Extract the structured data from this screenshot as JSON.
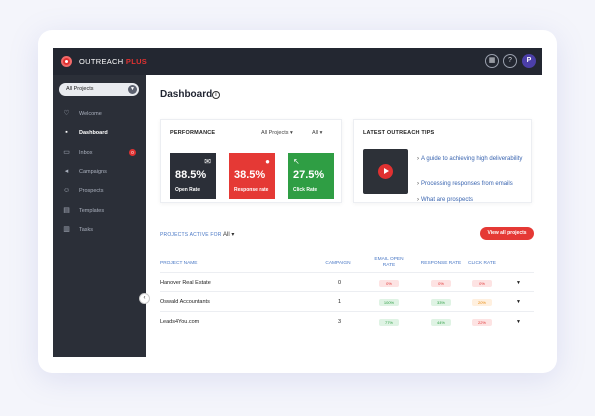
{
  "app": {
    "brand_name": "OUTREACH",
    "brand_suffix": "PLUS",
    "brand_color": "#e03131"
  },
  "topbar": {
    "icons": [
      "calendar-icon",
      "help-icon"
    ],
    "avatar_initial": "P"
  },
  "sidebar": {
    "project_select": "All Projects",
    "items": [
      {
        "label": "Welcome",
        "icon": "lightbulb-icon",
        "active": false
      },
      {
        "label": "Dashboard",
        "icon": "grid-icon",
        "active": true
      },
      {
        "label": "Inbox",
        "icon": "inbox-icon",
        "active": false,
        "badge": "0"
      },
      {
        "label": "Campaigns",
        "icon": "megaphone-icon",
        "active": false
      },
      {
        "label": "Prospects",
        "icon": "people-icon",
        "active": false
      },
      {
        "label": "Templates",
        "icon": "template-icon",
        "active": false
      },
      {
        "label": "Tasks",
        "icon": "tasks-icon",
        "active": false
      }
    ]
  },
  "page": {
    "title": "Dashboard",
    "info": "i"
  },
  "performance": {
    "title": "PERFORMANCE",
    "project_filter": "All Projects",
    "scope_filter": "All",
    "stats": [
      {
        "value": "88.5%",
        "label": "Open Rate",
        "color": "#2b2f38",
        "icon": "envelope-open-icon"
      },
      {
        "value": "38.5%",
        "label": "Response rate",
        "color": "#e53935",
        "icon": "chat-bubble-icon"
      },
      {
        "value": "27.5%",
        "label": "Click Rate",
        "color": "#2f9e44",
        "icon": "arrow-up-left-icon"
      }
    ]
  },
  "tips": {
    "title": "LATEST OUTREACH TIPS",
    "links": [
      "A guide to achieving high deliverability",
      "Processing responses from emails",
      "What are prospects"
    ]
  },
  "projects": {
    "active_for_label": "PROJECTS ACTIVE FOR",
    "active_for_value": "All",
    "view_all_label": "View all projects",
    "columns": [
      "PROJECT NAME",
      "CAMPAIGN",
      "EMAIL OPEN RATE",
      "RESPONSE RATE",
      "CLICK RATE"
    ],
    "rows": [
      {
        "name": "Hanover Real Estate",
        "campaign": "0",
        "open": "0%",
        "open_status": "red",
        "response": "0%",
        "response_status": "red",
        "click": "0%",
        "click_status": "red"
      },
      {
        "name": "Oswald Accountants",
        "campaign": "1",
        "open": "100%",
        "open_status": "green",
        "response": "33%",
        "response_status": "green",
        "click": "20%",
        "click_status": "orange"
      },
      {
        "name": "Leads4You.com",
        "campaign": "3",
        "open": "77%",
        "open_status": "green",
        "response": "44%",
        "response_status": "green",
        "click": "22%",
        "click_status": "red"
      }
    ]
  }
}
